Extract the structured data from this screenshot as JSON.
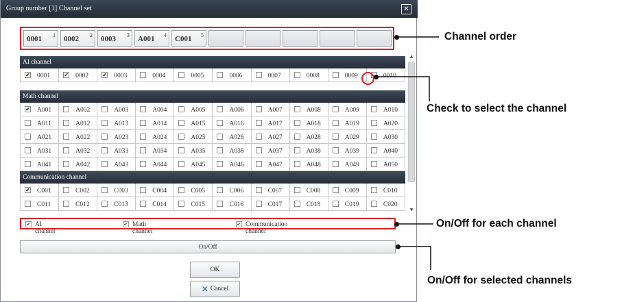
{
  "window": {
    "title": "Group number [1] Channel set",
    "close_icon": "close-icon"
  },
  "channel_order": [
    {
      "code": "0001",
      "index": "1"
    },
    {
      "code": "0002",
      "index": "2"
    },
    {
      "code": "0003",
      "index": "3"
    },
    {
      "code": "A001",
      "index": "4"
    },
    {
      "code": "C001",
      "index": "5"
    },
    {
      "code": "",
      "index": ""
    },
    {
      "code": "",
      "index": ""
    },
    {
      "code": "",
      "index": ""
    },
    {
      "code": "",
      "index": ""
    },
    {
      "code": "",
      "index": ""
    }
  ],
  "sections": [
    {
      "name": "AI channel",
      "rows": [
        [
          "0001",
          "0002",
          "0003",
          "0004",
          "0005",
          "0006",
          "0007",
          "0008",
          "0009",
          "0010"
        ]
      ],
      "checked": [
        "0001",
        "0002",
        "0003"
      ]
    },
    {
      "name": "Math channel",
      "rows": [
        [
          "A001",
          "A002",
          "A003",
          "A004",
          "A005",
          "A006",
          "A007",
          "A008",
          "A009",
          "A010"
        ],
        [
          "A011",
          "A012",
          "A013",
          "A014",
          "A015",
          "A016",
          "A017",
          "A018",
          "A019",
          "A020"
        ],
        [
          "A021",
          "A022",
          "A023",
          "A024",
          "A025",
          "A026",
          "A027",
          "A028",
          "A029",
          "A030"
        ],
        [
          "A031",
          "A032",
          "A033",
          "A034",
          "A035",
          "A036",
          "A037",
          "A038",
          "A039",
          "A040"
        ],
        [
          "A041",
          "A042",
          "A043",
          "A044",
          "A045",
          "A046",
          "A047",
          "A048",
          "A049",
          "A050"
        ]
      ],
      "checked": [
        "A001"
      ]
    },
    {
      "name": "Communication channel",
      "rows": [
        [
          "C001",
          "C002",
          "C003",
          "C004",
          "C005",
          "C006",
          "C007",
          "C008",
          "C009",
          "C010"
        ],
        [
          "C011",
          "C012",
          "C013",
          "C014",
          "C015",
          "C016",
          "C017",
          "C018",
          "C019",
          "C020"
        ]
      ],
      "checked": [
        "C001"
      ]
    }
  ],
  "group_toggles": [
    {
      "label": "AI channel",
      "checked": true
    },
    {
      "label": "Math channel",
      "checked": true
    },
    {
      "label": "Communication channel",
      "checked": true
    }
  ],
  "onoff_button": "On/Off",
  "ok_button": "OK",
  "cancel_button": "Cancel",
  "annotations": {
    "channel_order": "Channel order",
    "check_select": "Check to select the channel",
    "onoff_each": "On/Off for each channel",
    "onoff_selected": "On/Off for selected channels"
  },
  "colors": {
    "highlight": "#e02020",
    "header": "#2e3844"
  }
}
